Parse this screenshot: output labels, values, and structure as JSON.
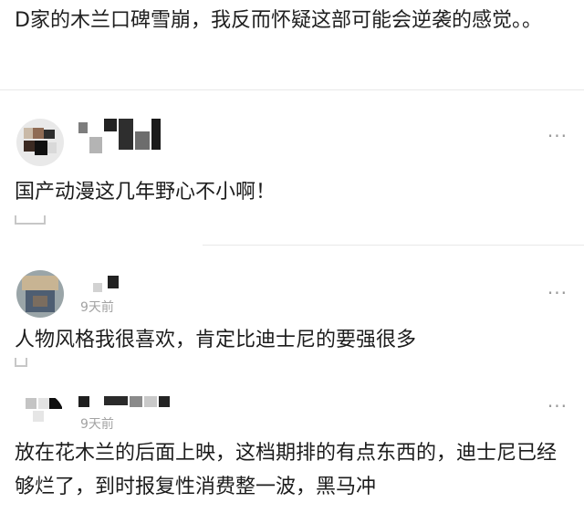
{
  "post": {
    "text": "D家的木兰口碑雪崩，我反而怀疑这部可能会逆袭的感觉。。"
  },
  "comments": [
    {
      "time": "",
      "more": "···",
      "text": "国产动漫这几年野心不小啊！"
    },
    {
      "time": "9天前",
      "more": "···",
      "text": "人物风格我很喜欢，肯定比迪士尼的要强很多"
    },
    {
      "time": "9天前",
      "more": "···",
      "text": "放在花木兰的后面上映，这档期排的有点东西的，迪士尼已经够烂了，到时报复性消费整一波，黑马冲"
    }
  ],
  "colors": {
    "text": "#1c1c1c",
    "muted": "#a3a3a3",
    "divider": "#e8e8e8"
  }
}
